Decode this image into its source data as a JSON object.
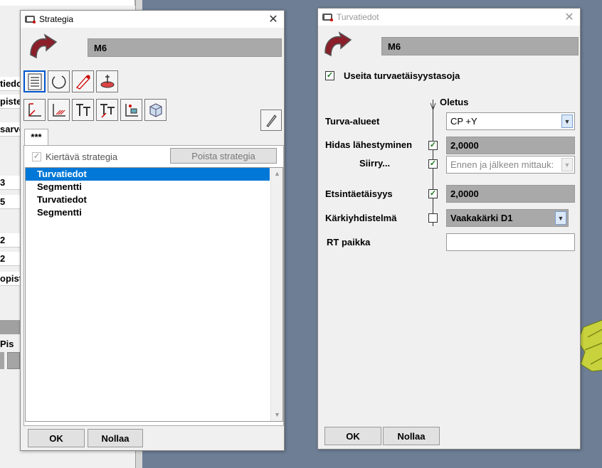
{
  "background": {
    "rows": [
      "tiedot",
      "piste",
      "sarvo",
      "3",
      "5",
      "2",
      "2",
      "opist",
      "Pis"
    ]
  },
  "strategia_dialog": {
    "title": "Strategia",
    "name_value": "M6",
    "tab_label": "***",
    "rotating_label": "Kiertävä strategia",
    "delete_button": "Poista strategia",
    "list_items": [
      "Turvatiedot",
      "Segmentti",
      "Turvatiedot",
      "Segmentti"
    ],
    "selected_index": 0,
    "ok_label": "OK",
    "reset_label": "Nollaa",
    "close_glyph": "✕"
  },
  "turva_dialog": {
    "title": "Turvatiedot",
    "name_value": "M6",
    "multi_levels_label": "Useita turvaetäisyystasoja",
    "multi_levels_checked": true,
    "default_label": "Oletus",
    "safety_zones_label": "Turva-alueet",
    "safety_zones_value": "CP +Y",
    "slow_approach_label": "Hidas lähestyminen",
    "slow_approach_checked": true,
    "slow_approach_value": "2,0000",
    "move_label": "Siirry...",
    "move_checked": true,
    "move_value": "Ennen ja jälkeen mittauk:",
    "search_distance_label": "Etsintäetäisyys",
    "search_distance_checked": true,
    "search_distance_value": "2,0000",
    "probe_combo_label": "Kärkiyhdistelmä",
    "probe_combo_checked": false,
    "probe_combo_value": "Vaakakärki D1",
    "rt_location_label": "RT paikka",
    "rt_location_value": "",
    "ok_label": "OK",
    "reset_label": "Nollaa",
    "close_glyph": "✕"
  },
  "colors": {
    "selection": "#0078d7",
    "readonly_field": "#a9a9a9",
    "check_green": "#1a7a1a",
    "desktop": "#6d7e95"
  },
  "icons": [
    "logo-icon",
    "list-icon",
    "circle-icon",
    "probe-icon",
    "plane-icon",
    "axis-icon",
    "hatch-axis-icon",
    "tt-icon",
    "tt-arrow-icon",
    "point-icon",
    "cube-icon",
    "pen-icon"
  ]
}
